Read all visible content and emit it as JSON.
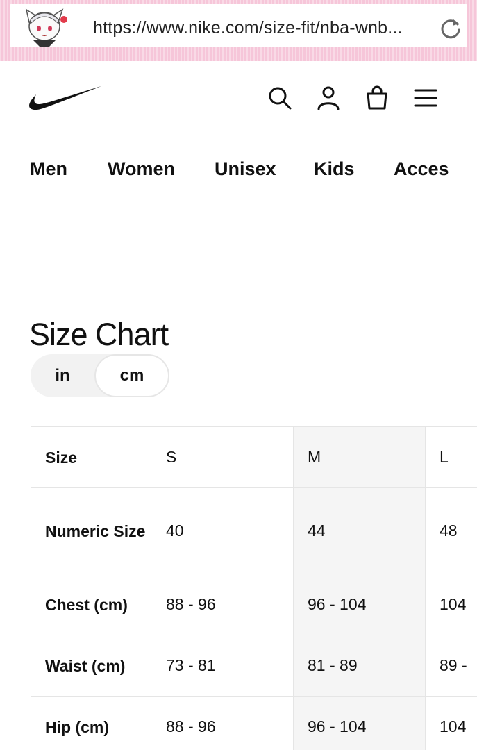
{
  "browser": {
    "url": "https://www.nike.com/size-fit/nba-wnb...",
    "reload_icon": "reload-icon",
    "avatar_icon": "anime-avatar-icon"
  },
  "header": {
    "logo": "nike-swoosh-icon",
    "icons": [
      "search-icon",
      "user-icon",
      "bag-icon",
      "menu-icon"
    ]
  },
  "categories": [
    "Men",
    "Women",
    "Unisex",
    "Kids",
    "Acces"
  ],
  "page": {
    "title": "Size Chart"
  },
  "unit_toggle": {
    "options": [
      "in",
      "cm"
    ],
    "selected": "cm"
  },
  "table": {
    "header": {
      "label": "Size",
      "values": [
        "S",
        "M",
        "L"
      ]
    },
    "rows": [
      {
        "label": "Numeric Size",
        "values": [
          "40",
          "44",
          "48"
        ]
      },
      {
        "label": "Chest (cm)",
        "values": [
          "88 - 96",
          "96 - 104",
          "104"
        ]
      },
      {
        "label": "Waist (cm)",
        "values": [
          "73 - 81",
          "81 - 89",
          "89 -"
        ]
      },
      {
        "label": "Hip (cm)",
        "values": [
          "88 - 96",
          "96 - 104",
          "104"
        ]
      }
    ]
  },
  "colors": {
    "address_frame": "#f6c6d9",
    "text": "#111111",
    "toggle_bg": "#f2f2f2",
    "highlight_col": "#f5f5f5",
    "border": "#e5e5e5"
  }
}
